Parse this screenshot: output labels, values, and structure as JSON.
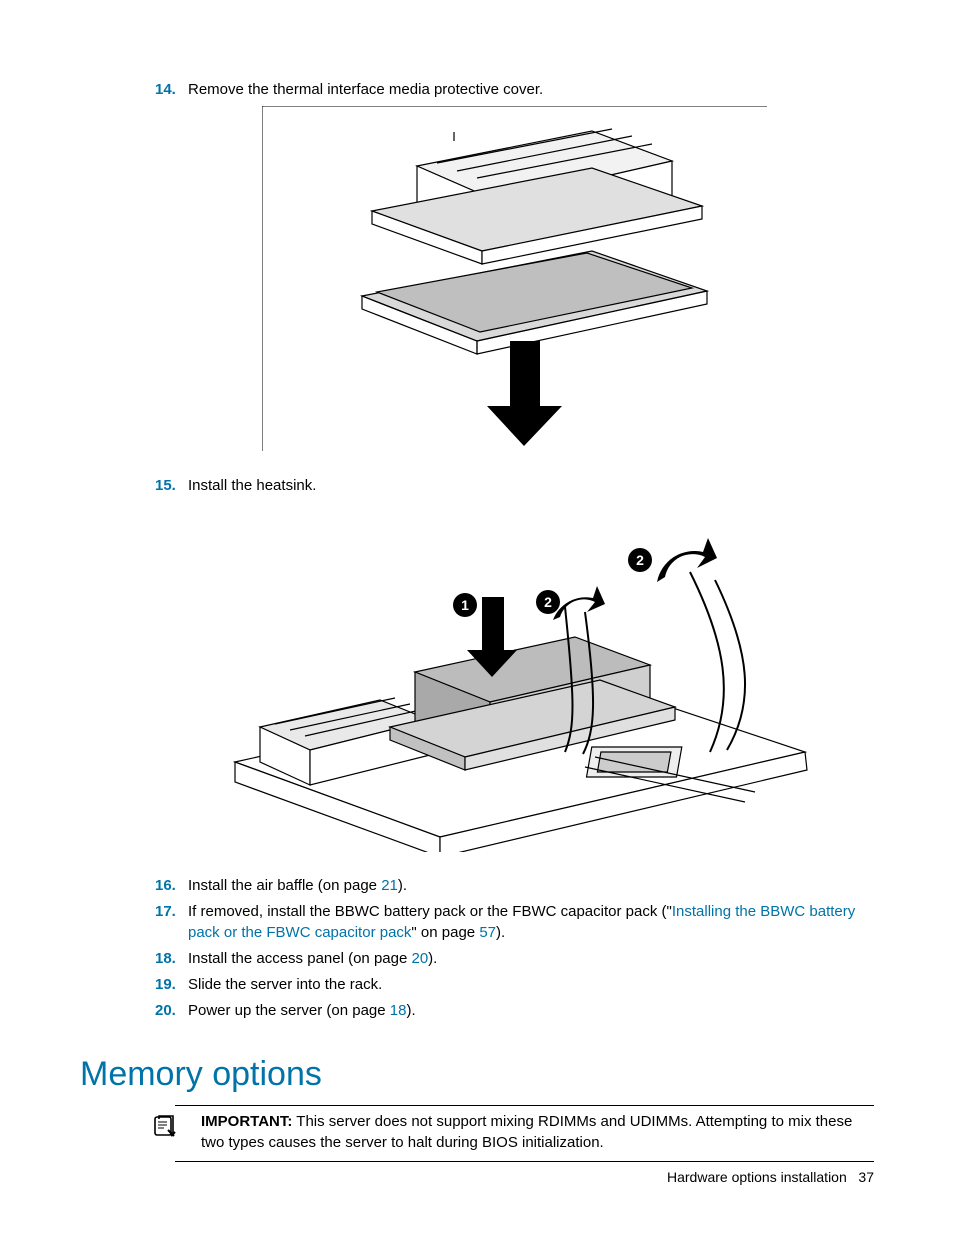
{
  "steps": {
    "s14": {
      "num": "14.",
      "text": "Remove the thermal interface media protective cover."
    },
    "s15": {
      "num": "15.",
      "text": "Install the heatsink."
    },
    "s16": {
      "num": "16.",
      "pre": "Install the air baffle (on page ",
      "link": "21",
      "post": ")."
    },
    "s17": {
      "num": "17.",
      "pre": "If removed, install the BBWC battery pack or the FBWC capacitor pack (\"",
      "link1": "Installing the BBWC battery pack or the FBWC capacitor pack",
      "mid": "\" on page ",
      "link2": "57",
      "post": ")."
    },
    "s18": {
      "num": "18.",
      "pre": "Install the access panel (on page ",
      "link": "20",
      "post": ")."
    },
    "s19": {
      "num": "19.",
      "text": "Slide the server into the rack."
    },
    "s20": {
      "num": "20.",
      "pre": "Power up the server (on page ",
      "link": "18",
      "post": ")."
    }
  },
  "section": {
    "heading": "Memory options"
  },
  "note": {
    "label": "IMPORTANT:",
    "body": "   This server does not support mixing RDIMMs and UDIMMs. Attempting to mix these two types causes the server to halt during BIOS initialization."
  },
  "footer": {
    "chapter": "Hardware options installation",
    "page": "37"
  }
}
